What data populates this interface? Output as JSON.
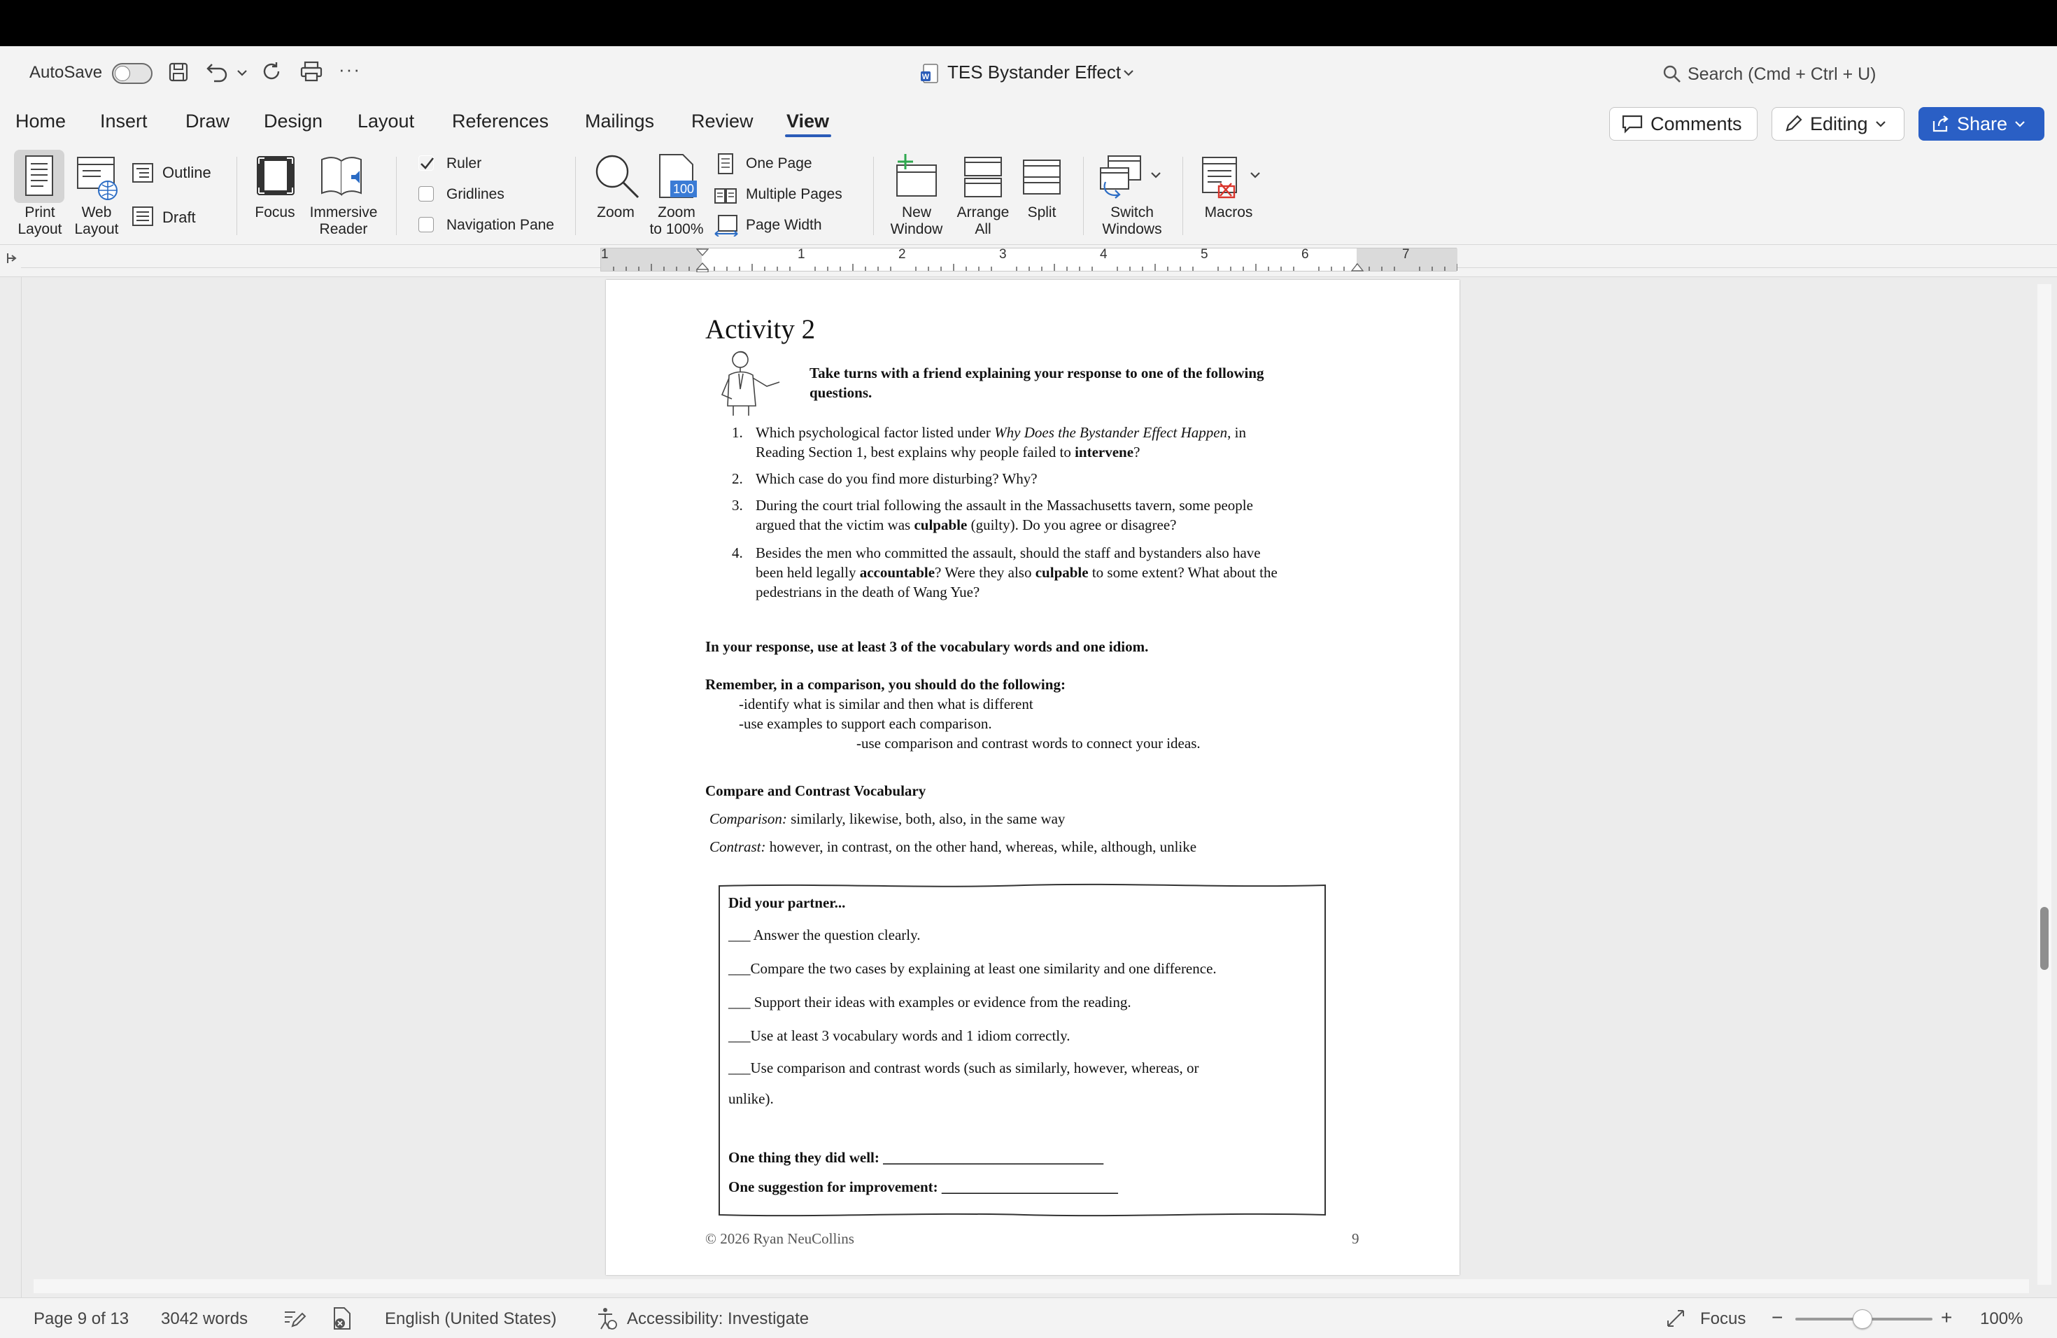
{
  "titlebar": {
    "autosave_label": "AutoSave",
    "doc_title": "TES Bystander Effect",
    "search_placeholder": "Search (Cmd + Ctrl + U)",
    "more": "···"
  },
  "tabs": [
    "Home",
    "Insert",
    "Draw",
    "Design",
    "Layout",
    "References",
    "Mailings",
    "Review",
    "View"
  ],
  "active_tab": "View",
  "actions": {
    "comments": "Comments",
    "editing": "Editing",
    "share": "Share"
  },
  "ribbon": {
    "print_layout": [
      "Print",
      "Layout"
    ],
    "web_layout": [
      "Web",
      "Layout"
    ],
    "outline": "Outline",
    "draft": "Draft",
    "focus": "Focus",
    "immersive_reader": [
      "Immersive",
      "Reader"
    ],
    "ruler": "Ruler",
    "gridlines": "Gridlines",
    "navigation_pane": "Navigation Pane",
    "zoom": "Zoom",
    "zoom_100": [
      "Zoom",
      "to 100%"
    ],
    "zoom_100_badge": "100",
    "one_page": "One Page",
    "multiple_pages": "Multiple Pages",
    "page_width": "Page Width",
    "new_window": [
      "New",
      "Window"
    ],
    "arrange_all": [
      "Arrange",
      "All"
    ],
    "split": "Split",
    "switch_windows": [
      "Switch",
      "Windows"
    ],
    "macros": "Macros"
  },
  "ruler_numbers": [
    "1",
    "1",
    "2",
    "3",
    "4",
    "5",
    "6",
    "7"
  ],
  "document": {
    "heading": "Activity 2",
    "intro_line1": "Take turns with a friend explaining your response to one of the following",
    "intro_line2": "questions.",
    "q1_num": "1.",
    "q1_a": "Which psychological factor listed under ",
    "q1_b": "Why Does the Bystander Effect Happen",
    "q1_c": ", in",
    "q1_d": "Reading Section 1, best explains why people failed to ",
    "q1_e": "intervene",
    "q1_f": "?",
    "q2_num": "2.",
    "q2": "Which case do you find more disturbing? Why?",
    "q3_num": "3.",
    "q3_a": "During the court trial following the assault in the Massachusetts tavern, some people",
    "q3_b": "argued that the victim was ",
    "q3_c": "culpable",
    "q3_d": " (guilty). Do you agree or disagree?",
    "q4_num": "4.",
    "q4_a": "Besides the men who committed the assault, should the staff and bystanders also have",
    "q4_b": "been held legally ",
    "q4_c": "accountable",
    "q4_d": "? Were they also ",
    "q4_e": "culpable",
    "q4_f": " to some extent? What about the",
    "q4_g": "pedestrians in the death of Wang Yue?",
    "vocab_note": "In your response, use at least 3 of the vocabulary words and one idiom.",
    "remember": "Remember, in a comparison, you should do the following:",
    "r1": "-identify what is similar and then what is different",
    "r2": "-use examples to support each comparison.",
    "r3": "-use comparison and contrast words to connect your ideas.",
    "vocab_heading": "Compare and Contrast Vocabulary",
    "comparison_label": "Comparison:",
    "comparison_words": " similarly, likewise, both, also, in the same way",
    "contrast_label": "Contrast:",
    "contrast_words": " however, in contrast, on the other hand, whereas, while, although, unlike",
    "box_title": "Did your partner...",
    "c1": "___ Answer the question clearly.",
    "c2": "___Compare the two cases by explaining at least one similarity and one difference.",
    "c3": "___ Support their ideas with examples or evidence from the reading.",
    "c4": "___Use at least 3 vocabulary words and 1 idiom correctly.",
    "c5a": "___Use comparison and contrast words (such as similarly, however, whereas, or",
    "c5b": "unlike).",
    "did_well": "One thing they did well: ______________________________",
    "suggestion": "One suggestion for improvement: ________________________",
    "footer_copy": "© 2026 Ryan NeuCollins",
    "page_number": "9"
  },
  "status": {
    "page": "Page 9 of 13",
    "words": "3042 words",
    "language": "English (United States)",
    "accessibility": "Accessibility: Investigate",
    "focus": "Focus",
    "zoom": "100%",
    "minus": "−",
    "plus": "+"
  },
  "colors": {
    "accent": "#2b5cb8",
    "share_bg": "#2a5fc5",
    "tab_underline": "#2b5cb8"
  }
}
